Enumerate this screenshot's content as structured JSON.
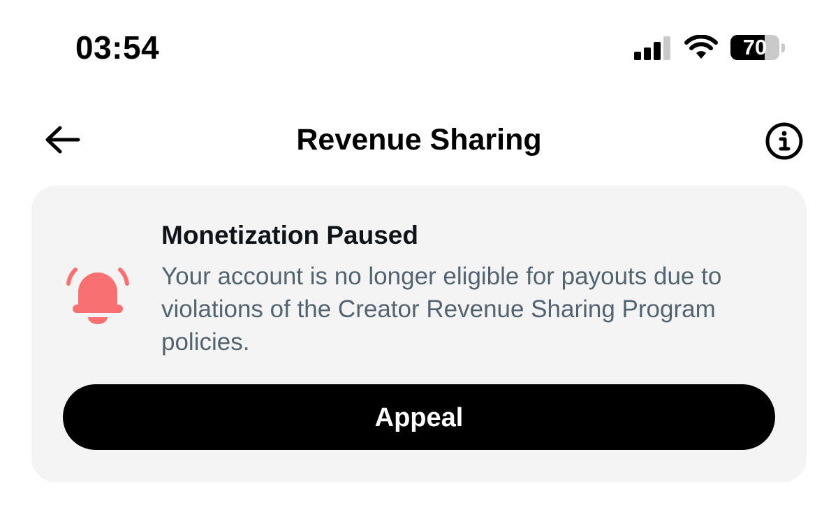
{
  "status_bar": {
    "time": "03:54",
    "battery_level": "70",
    "battery_fraction": 0.7,
    "icons": [
      "signal-icon",
      "wifi-icon",
      "battery-icon"
    ]
  },
  "header": {
    "title": "Revenue Sharing",
    "back_icon": "back-arrow-icon",
    "info_icon": "info-icon"
  },
  "alert_card": {
    "icon": "bell-icon",
    "icon_color": "#f87171",
    "title": "Monetization Paused",
    "message": "Your account is no longer eligible for payouts due to violations of the Creator Revenue Sharing Program policies.",
    "button_label": "Appeal"
  },
  "colors": {
    "card_background": "#f4f4f4",
    "button_background": "#000000",
    "button_text": "#ffffff",
    "message_text": "#536471"
  }
}
